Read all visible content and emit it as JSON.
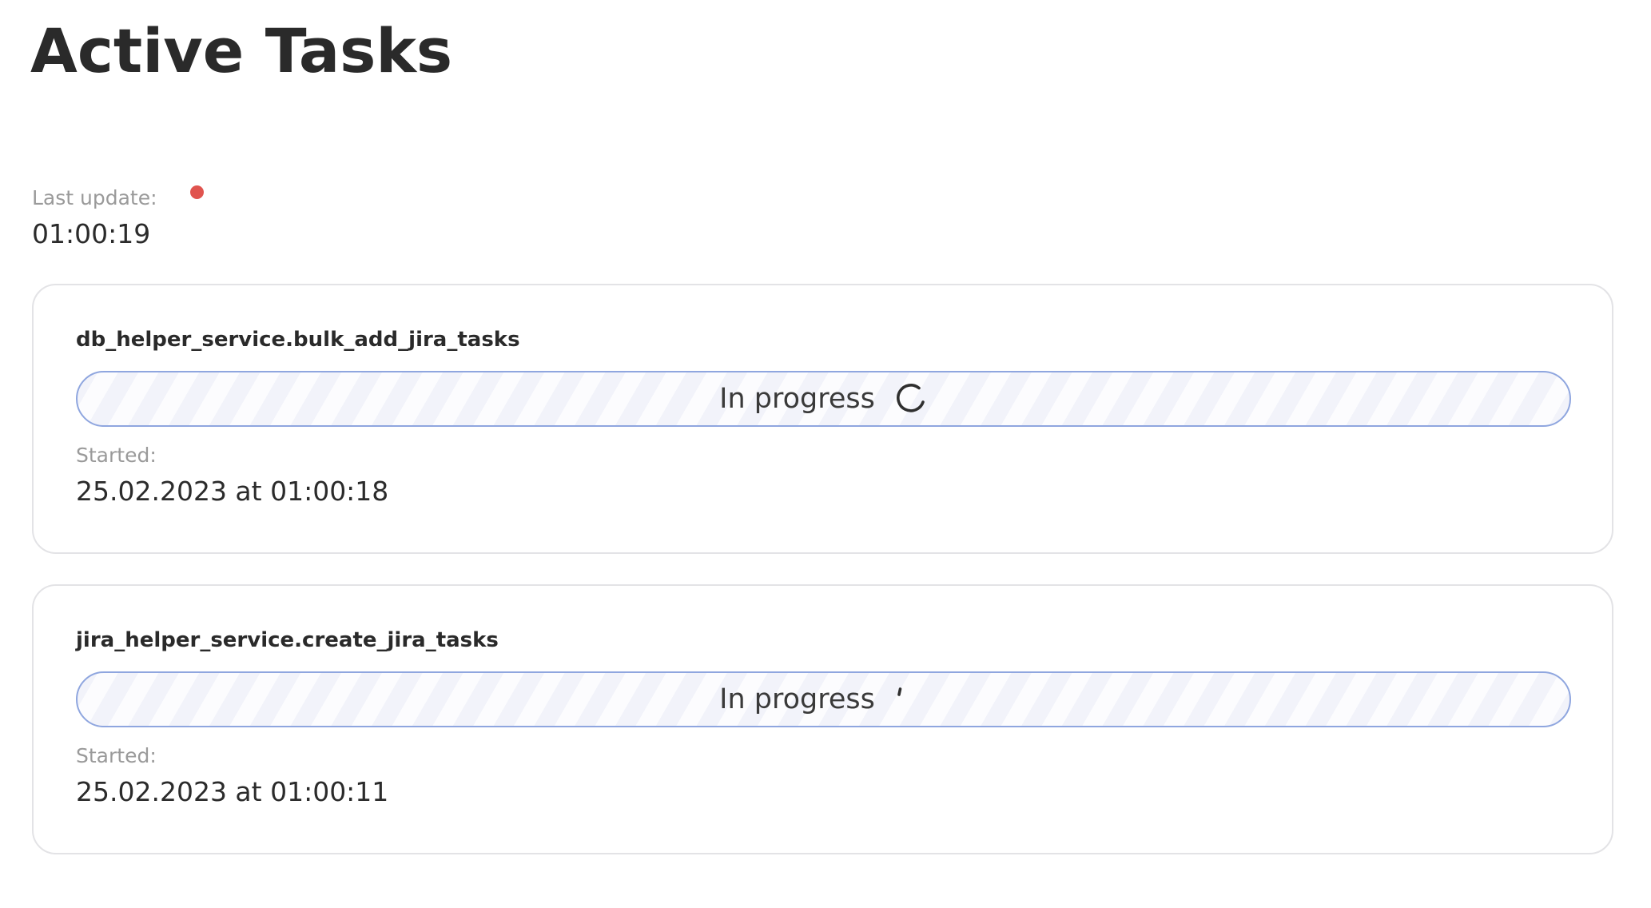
{
  "page": {
    "title": "Active Tasks"
  },
  "last_update": {
    "label": "Last update:",
    "value": "01:00:19",
    "indicator_color": "#e0544f"
  },
  "tasks": [
    {
      "name": "db_helper_service.bulk_add_jira_tasks",
      "status": "In progress",
      "status_icon": "spinner-icon",
      "started_label": "Started:",
      "started_value": "25.02.2023 at 01:00:18"
    },
    {
      "name": "jira_helper_service.create_jira_tasks",
      "status": "In progress",
      "status_icon": "spinner-icon",
      "started_label": "Started:",
      "started_value": "25.02.2023 at 01:00:11"
    }
  ],
  "colors": {
    "progress_border": "#8fa6df",
    "progress_background": "#f2f3fa",
    "card_border": "#e3e3e6"
  }
}
